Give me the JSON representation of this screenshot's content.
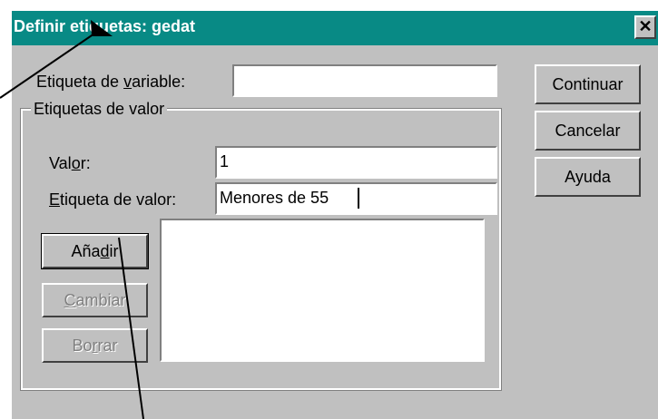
{
  "window": {
    "title": "Definir etiquetas: gedat",
    "close_label": "✕"
  },
  "variable_label": {
    "label_pre": "Etiqueta de ",
    "label_u": "v",
    "label_post": "ariable:",
    "value": ""
  },
  "value_labels_group": {
    "caption": "Etiquetas de valor",
    "value_field": {
      "label_pre": "Val",
      "label_u": "o",
      "label_post": "r:",
      "value": "1"
    },
    "value_label_field": {
      "label_pre": "",
      "label_u": "E",
      "label_post": "tiqueta de valor:",
      "value": "Menores de 55"
    },
    "buttons": {
      "add": {
        "pre": "Aña",
        "u": "d",
        "post": "ir"
      },
      "change": {
        "pre": "",
        "u": "C",
        "post": "ambiar"
      },
      "delete": {
        "pre": "Bo",
        "u": "r",
        "post": "rar"
      }
    },
    "list_items": []
  },
  "side_buttons": {
    "continue": "Continuar",
    "cancel": "Cancelar",
    "help": "Ayuda"
  },
  "colors": {
    "titlebar": "#088a85",
    "face": "#c0c0c0",
    "field": "#ffffff"
  }
}
